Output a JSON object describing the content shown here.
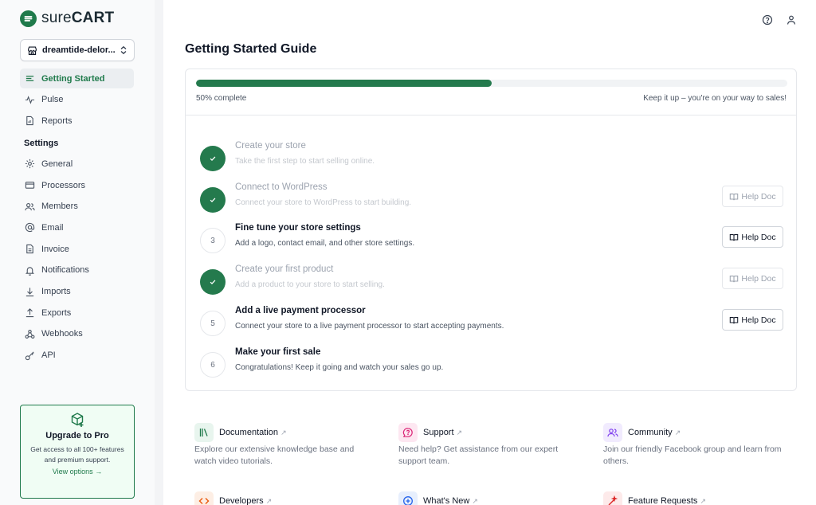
{
  "brand": {
    "name_light": "sure",
    "name_bold": "CART",
    "accent": "#1f7a4b"
  },
  "store_selector": {
    "value": "dreamtide-delor..."
  },
  "nav": {
    "primary": [
      {
        "label": "Getting Started",
        "icon": "list-icon",
        "active": true
      },
      {
        "label": "Pulse",
        "icon": "pulse-icon"
      },
      {
        "label": "Reports",
        "icon": "report-icon"
      }
    ],
    "settings_heading": "Settings",
    "settings": [
      {
        "label": "General",
        "icon": "gear-icon"
      },
      {
        "label": "Processors",
        "icon": "credit-card-icon"
      },
      {
        "label": "Members",
        "icon": "users-icon"
      },
      {
        "label": "Email",
        "icon": "at-icon"
      },
      {
        "label": "Invoice",
        "icon": "invoice-icon"
      },
      {
        "label": "Notifications",
        "icon": "bell-icon"
      },
      {
        "label": "Imports",
        "icon": "download-icon"
      },
      {
        "label": "Exports",
        "icon": "upload-icon"
      },
      {
        "label": "Webhooks",
        "icon": "webhook-icon"
      },
      {
        "label": "API",
        "icon": "key-icon"
      }
    ]
  },
  "upgrade": {
    "title": "Upgrade to Pro",
    "description": "Get access to all 100+ features and premium support.",
    "link": "View options"
  },
  "header": {
    "help_icon": "help-circle-icon",
    "user_icon": "user-icon"
  },
  "page_title": "Getting Started Guide",
  "progress": {
    "fraction": 0.5,
    "label": "50% complete",
    "message": "Keep it up – you're on your way to sales!"
  },
  "steps": [
    {
      "number": "1",
      "done": true,
      "title": "Create your store",
      "description": "Take the first step to start selling online.",
      "help": null
    },
    {
      "number": "2",
      "done": true,
      "title": "Connect to WordPress",
      "description": "Connect your store to WordPress to start building.",
      "help": "Help Doc"
    },
    {
      "number": "3",
      "done": false,
      "title": "Fine tune your store settings",
      "description": "Add a logo, contact email, and other store settings.",
      "help": "Help Doc"
    },
    {
      "number": "4",
      "done": true,
      "title": "Create your first product",
      "description": "Add a product to your store to start selling.",
      "help": "Help Doc"
    },
    {
      "number": "5",
      "done": false,
      "title": "Add a live payment processor",
      "description": "Connect your store to a live payment processor to start accepting payments.",
      "help": "Help Doc"
    },
    {
      "number": "6",
      "done": false,
      "title": "Make your first sale",
      "description": "Congratulations! Keep it going and watch your sales go up.",
      "help": null
    }
  ],
  "resources": [
    {
      "title": "Documentation",
      "description": "Explore our extensive knowledge base and watch video tutorials.",
      "icon": "books-icon",
      "color": "#1f7a4b",
      "bg": "#e8f5ee"
    },
    {
      "title": "Support",
      "description": "Need help? Get assistance from our expert support team.",
      "icon": "chat-help-icon",
      "color": "#db2777",
      "bg": "#fde7f1"
    },
    {
      "title": "Community",
      "description": "Join our friendly Facebook group and learn from others.",
      "icon": "community-icon",
      "color": "#7c3aed",
      "bg": "#f1ebfe"
    },
    {
      "title": "Developers",
      "description": "",
      "icon": "code-icon",
      "color": "#ea580c",
      "bg": "#fdeee4"
    },
    {
      "title": "What's New",
      "description": "",
      "icon": "plus-circle-icon",
      "color": "#2563eb",
      "bg": "#e7effd"
    },
    {
      "title": "Feature Requests",
      "description": "",
      "icon": "wand-icon",
      "color": "#dc2626",
      "bg": "#fdeaea"
    }
  ]
}
